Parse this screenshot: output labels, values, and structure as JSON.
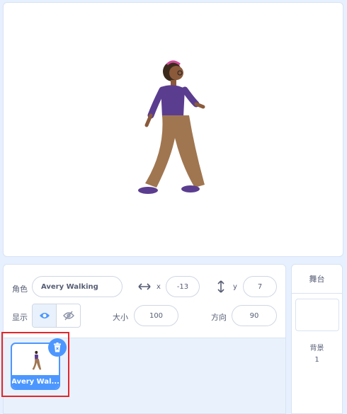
{
  "stage": {
    "sprite_name": "Avery Walking"
  },
  "sprite_info": {
    "sprite_label": "角色",
    "sprite_name": "Avery Walking",
    "x_label": "x",
    "x_value": "-13",
    "y_label": "y",
    "y_value": "7",
    "show_label": "显示",
    "size_label": "大小",
    "size_value": "100",
    "direction_label": "方向",
    "direction_value": "90",
    "visible": true
  },
  "sprite_list": {
    "items": [
      {
        "name": "Avery Wal...",
        "selected": true
      }
    ]
  },
  "stage_panel": {
    "title": "舞台",
    "backdrops_label": "背景",
    "backdrops_count": "1"
  },
  "colors": {
    "accent": "#4c97ff",
    "highlight_box": "#e4262b",
    "text": "#575e75"
  }
}
